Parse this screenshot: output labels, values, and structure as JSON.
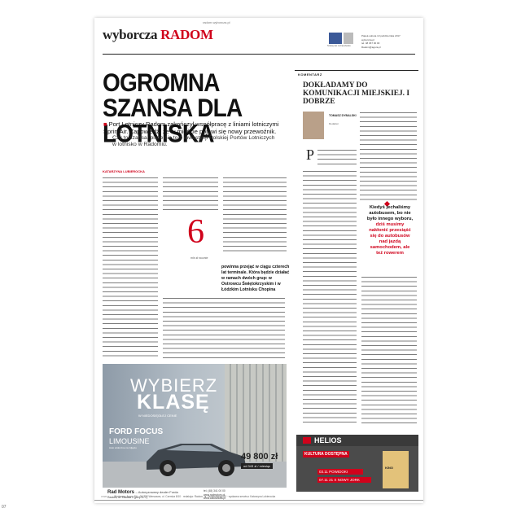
{
  "masthead": {
    "logo_main": "wyborcza",
    "logo_city": "RADOM",
    "url": "radom.wyborcza.pl",
    "social_label": "Szukaj nas na Facebooku",
    "info_lines": [
      "Piątek-sobota 13 października 2017",
      "wyborcza.pl",
      "tel. 48 367 00 00",
      "Radom@agora.pl"
    ]
  },
  "article": {
    "headline": "OGROMNA SZANSA DLA LOTNISKA",
    "lead": "Port Lotniczy Radom zakończył współpracę z liniami lotniczymi SprintAir. Zapowiedź, że w mieście pojawi się nowy przewoźnik.",
    "lead_sub": "Czy to szansa, pisze się to o inwestycji Polskiej Portów Lotniczych w lotnisko w Radomiu.",
    "byline": "KATARZYNA LUBIEROCKA",
    "fact_number": "6",
    "fact_caption": "mln zł rocznie",
    "fact_text": "powinna przejąć w ciągu czterech lat terminale. Która będzie działać w ramach dwóch grup: w Ostrowcu Świętokrzyskim i w Łódzkim Lotnisku Chopina"
  },
  "commentary": {
    "label": "KOMENTARZ",
    "title": "DOKŁADAMY DO KOMUNIKACJI MIEJSKIEJ. I DOBRZE",
    "author_name": "TOMASZ DYBALSKI",
    "author_role": "Redaktor",
    "dropcap": "P",
    "quote_part1": "Kiedyś jechaliśmy autobusem, bo nie było innego wyboru,",
    "quote_part2": "dziś musimy nakłonić przesiąść się do autobusów nad jazdą samochodem, ale też rowerem"
  },
  "ad": {
    "headline_1": "WYBIERZ",
    "headline_2": "KLASĘ",
    "tagline": "W NIEDOSIĘGŁEJ CENIE",
    "model": "FORD FOCUS",
    "model_sub": "LIMOUSINE",
    "fine_print": "Auto widoczne na zdjęciu",
    "price": "49 800 zł",
    "price_badge": "od 343 zł / miesiąc",
    "dealer": "Rad Motors",
    "dealer_desc": "– Autoryzowany dealer Forda",
    "dealer_addr": "Radom, ul. Okulna 1 (przy E77)",
    "dealer_contact": [
      "tel. (48) 341 00 00",
      "www.radmotors.pl",
      "www.autoszkoła.pl"
    ]
  },
  "helios": {
    "logo": "HELIOS",
    "tag": "KULTURA DOSTĘPNA",
    "row1": "03.11 POWIDOKI",
    "row2": "07.11 21 X NOWY JORK",
    "poster": "KINO"
  },
  "footer": {
    "text": "Wydawca: Agora SA · 00-732 Warszawa, ul. Czerska 8/10 · redakcja: Radom, ul. Żeromskiego 53 · wydawca serwisu: Katarzyna Lubierocka",
    "ref": "OWR",
    "page_number": "07"
  },
  "colors": {
    "accent": "#d0021b",
    "text": "#222222"
  }
}
